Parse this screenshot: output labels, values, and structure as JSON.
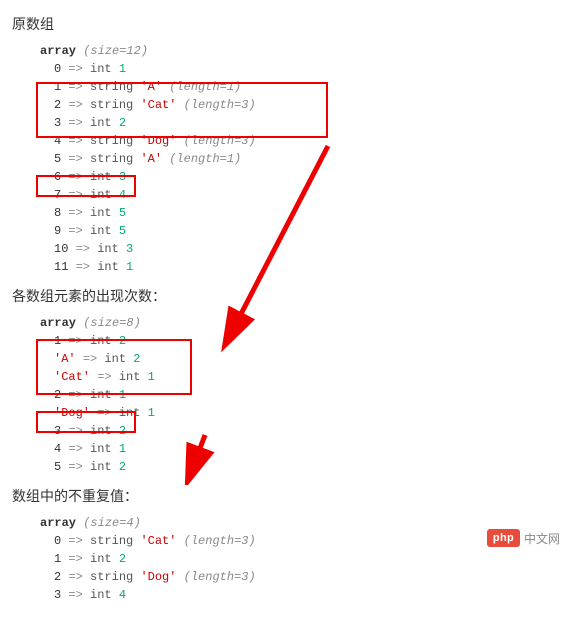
{
  "section1": {
    "title": "原数组",
    "header": [
      "array",
      " (size=12)"
    ],
    "rows": [
      {
        "k": "0",
        "kw": "int",
        "v": "1"
      },
      {
        "k": "1",
        "kw": "string",
        "v": "'A'",
        "extra": "(length=1)"
      },
      {
        "k": "2",
        "kw": "string",
        "v": "'Cat'",
        "extra": "(length=3)"
      },
      {
        "k": "3",
        "kw": "int",
        "v": "2"
      },
      {
        "k": "4",
        "kw": "string",
        "v": "'Dog'",
        "extra": "(length=3)"
      },
      {
        "k": "5",
        "kw": "string",
        "v": "'A'",
        "extra": "(length=1)"
      },
      {
        "k": "6",
        "kw": "int",
        "v": "3"
      },
      {
        "k": "7",
        "kw": "int",
        "v": "4"
      },
      {
        "k": "8",
        "kw": "int",
        "v": "5"
      },
      {
        "k": "9",
        "kw": "int",
        "v": "5"
      },
      {
        "k": "10",
        "kw": "int",
        "v": "3"
      },
      {
        "k": "11",
        "kw": "int",
        "v": "1"
      }
    ]
  },
  "section2": {
    "title": "各数组元素的出现次数：",
    "header": [
      "array",
      " (size=8)"
    ],
    "rows": [
      {
        "k": "1",
        "kw": "int",
        "v": "2"
      },
      {
        "k": "'A'",
        "kw": "int",
        "v": "2"
      },
      {
        "k": "'Cat'",
        "kw": "int",
        "v": "1"
      },
      {
        "k": "2",
        "kw": "int",
        "v": "1"
      },
      {
        "k": "'Dog'",
        "kw": "int",
        "v": "1"
      },
      {
        "k": "3",
        "kw": "int",
        "v": "2"
      },
      {
        "k": "4",
        "kw": "int",
        "v": "1"
      },
      {
        "k": "5",
        "kw": "int",
        "v": "2"
      }
    ]
  },
  "section3": {
    "title": "数组中的不重复值：",
    "header": [
      "array",
      " (size=4)"
    ],
    "rows": [
      {
        "k": "0",
        "kw": "string",
        "v": "'Cat'",
        "extra": "(length=3)"
      },
      {
        "k": "1",
        "kw": "int",
        "v": "2"
      },
      {
        "k": "2",
        "kw": "string",
        "v": "'Dog'",
        "extra": "(length=3)"
      },
      {
        "k": "3",
        "kw": "int",
        "v": "4"
      }
    ]
  },
  "brand": {
    "badge": "php",
    "text": "中文网"
  },
  "arrow_glyph": "=>"
}
